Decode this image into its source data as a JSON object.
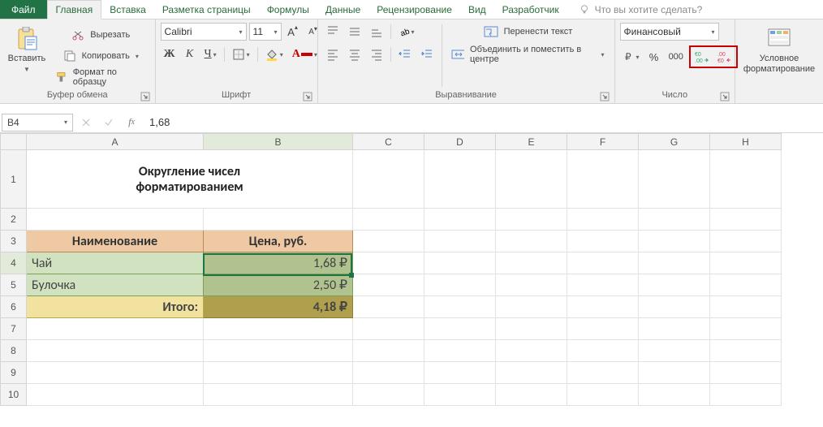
{
  "tabs": {
    "file": "Файл",
    "home": "Главная",
    "insert": "Вставка",
    "layout": "Разметка страницы",
    "formulas": "Формулы",
    "data": "Данные",
    "review": "Рецензирование",
    "view": "Вид",
    "developer": "Разработчик",
    "tell_me": "Что вы хотите сделать?"
  },
  "ribbon": {
    "clipboard": {
      "title": "Буфер обмена",
      "paste": "Вставить",
      "cut": "Вырезать",
      "copy": "Копировать",
      "format_painter": "Формат по образцу"
    },
    "font": {
      "title": "Шрифт",
      "name": "Calibri",
      "size": "11"
    },
    "alignment": {
      "title": "Выравнивание",
      "wrap": "Перенести текст",
      "merge": "Объединить и поместить в центре"
    },
    "number": {
      "title": "Число",
      "format": "Финансовый"
    },
    "cond": {
      "title": "",
      "label": "Условное форматирование"
    }
  },
  "formula_bar": {
    "name_box": "B4",
    "formula": "1,68"
  },
  "columns": [
    "A",
    "B",
    "C",
    "D",
    "E",
    "F",
    "G",
    "H"
  ],
  "rows": [
    "1",
    "2",
    "3",
    "4",
    "5",
    "6",
    "7",
    "8",
    "9",
    "10"
  ],
  "content": {
    "title_line1": "Округление чисел",
    "title_line2": "форматированием",
    "hdr_name": "Наименование",
    "hdr_price": "Цена, руб.",
    "r1_name": "Чай",
    "r1_price": "1,68 ₽",
    "r2_name": "Булочка",
    "r2_price": "2,50 ₽",
    "total_label": "Итого:",
    "total_price": "4,18 ₽"
  },
  "active_cell": "B4",
  "chart_data": {
    "type": "table",
    "title": "Округление чисел форматированием",
    "columns": [
      "Наименование",
      "Цена, руб."
    ],
    "rows": [
      {
        "Наименование": "Чай",
        "Цена, руб.": 1.68
      },
      {
        "Наименование": "Булочка",
        "Цена, руб.": 2.5
      },
      {
        "Наименование": "Итого:",
        "Цена, руб.": 4.18
      }
    ],
    "currency": "₽"
  }
}
